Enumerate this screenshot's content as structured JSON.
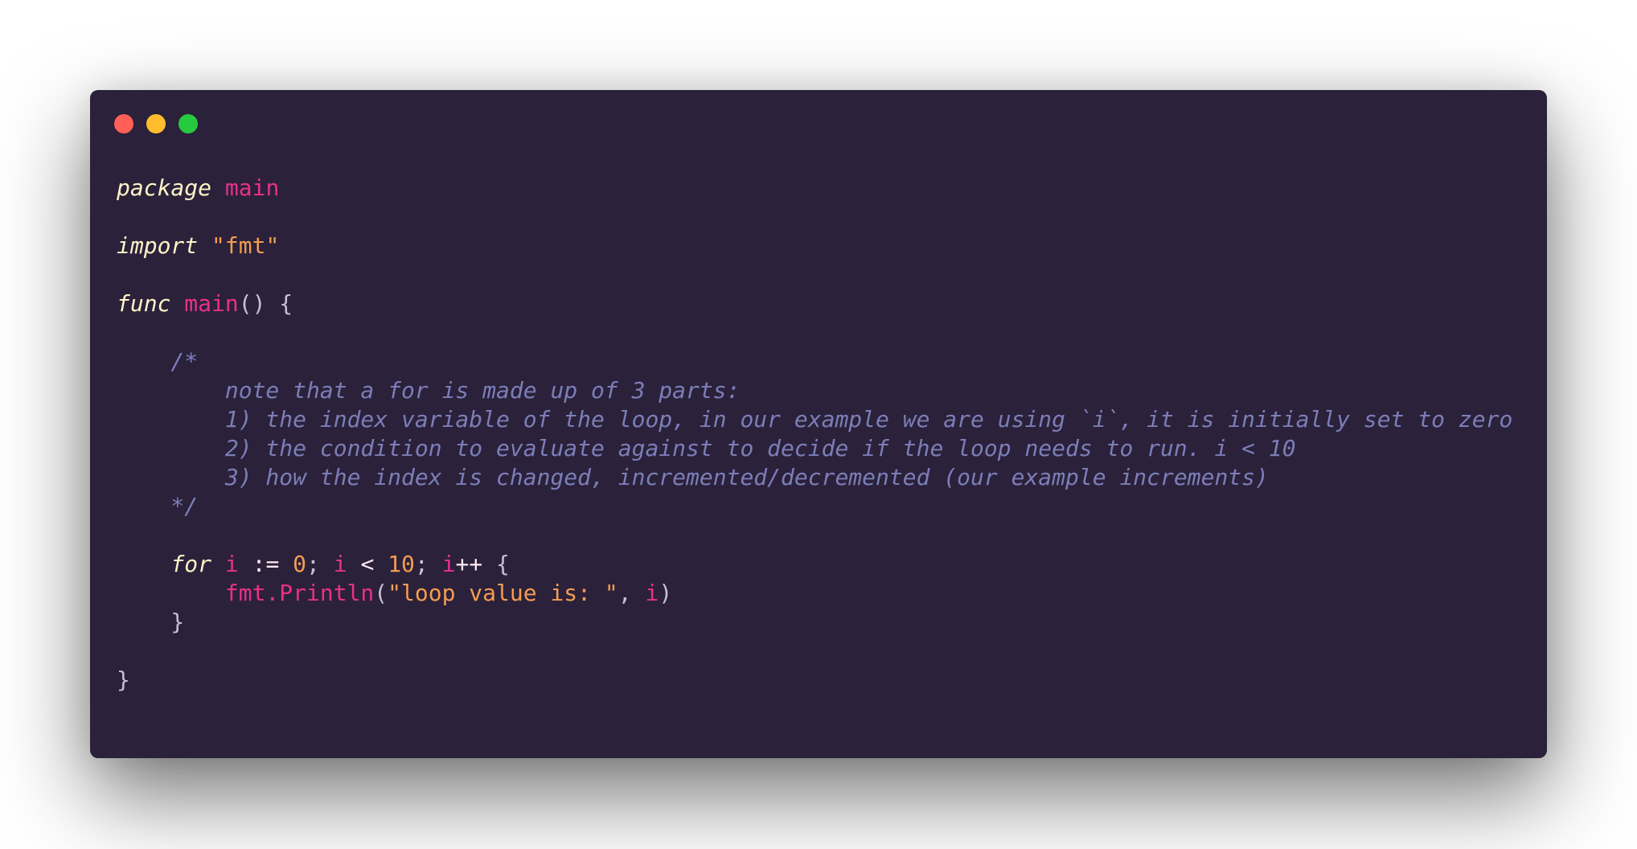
{
  "window": {
    "controls": [
      {
        "name": "close",
        "color": "#ff5f56"
      },
      {
        "name": "minimize",
        "color": "#ffbd2e"
      },
      {
        "name": "maximize",
        "color": "#27c93f"
      }
    ]
  },
  "code": {
    "language": "go",
    "lines": [
      [
        {
          "t": "package",
          "c": "kw"
        },
        {
          "t": " ",
          "c": "pn"
        },
        {
          "t": "main",
          "c": "id"
        }
      ],
      [],
      [
        {
          "t": "import",
          "c": "kw"
        },
        {
          "t": " ",
          "c": "pn"
        },
        {
          "t": "\"fmt\"",
          "c": "str"
        }
      ],
      [],
      [
        {
          "t": "func",
          "c": "kw"
        },
        {
          "t": " ",
          "c": "pn"
        },
        {
          "t": "main",
          "c": "id"
        },
        {
          "t": "() {",
          "c": "pn"
        }
      ],
      [],
      [
        {
          "t": "    /*",
          "c": "cm"
        }
      ],
      [
        {
          "t": "        note that a for is made up of 3 parts:",
          "c": "cm"
        }
      ],
      [
        {
          "t": "        1) the index variable of the loop, in our example we are using `i`, it is initially set to zero",
          "c": "cm"
        }
      ],
      [
        {
          "t": "        2) the condition to evaluate against to decide if the loop needs to run. i < 10",
          "c": "cm"
        }
      ],
      [
        {
          "t": "        3) how the index is changed, incremented/decremented (our example increments)",
          "c": "cm"
        }
      ],
      [
        {
          "t": "    */",
          "c": "cm"
        }
      ],
      [],
      [
        {
          "t": "    ",
          "c": "pn"
        },
        {
          "t": "for",
          "c": "kw"
        },
        {
          "t": " ",
          "c": "pn"
        },
        {
          "t": "i",
          "c": "id"
        },
        {
          "t": " := ",
          "c": "op"
        },
        {
          "t": "0",
          "c": "num"
        },
        {
          "t": "; ",
          "c": "pn"
        },
        {
          "t": "i",
          "c": "id"
        },
        {
          "t": " < ",
          "c": "op"
        },
        {
          "t": "10",
          "c": "num"
        },
        {
          "t": "; ",
          "c": "pn"
        },
        {
          "t": "i",
          "c": "id"
        },
        {
          "t": "++",
          "c": "op"
        },
        {
          "t": " {",
          "c": "pn"
        }
      ],
      [
        {
          "t": "        ",
          "c": "pn"
        },
        {
          "t": "fmt.Println",
          "c": "id"
        },
        {
          "t": "(",
          "c": "pn"
        },
        {
          "t": "\"loop value is: \"",
          "c": "str"
        },
        {
          "t": ", ",
          "c": "pn"
        },
        {
          "t": "i",
          "c": "id"
        },
        {
          "t": ")",
          "c": "pn"
        }
      ],
      [
        {
          "t": "    }",
          "c": "pn"
        }
      ],
      [],
      [
        {
          "t": "}",
          "c": "pn"
        }
      ]
    ]
  }
}
